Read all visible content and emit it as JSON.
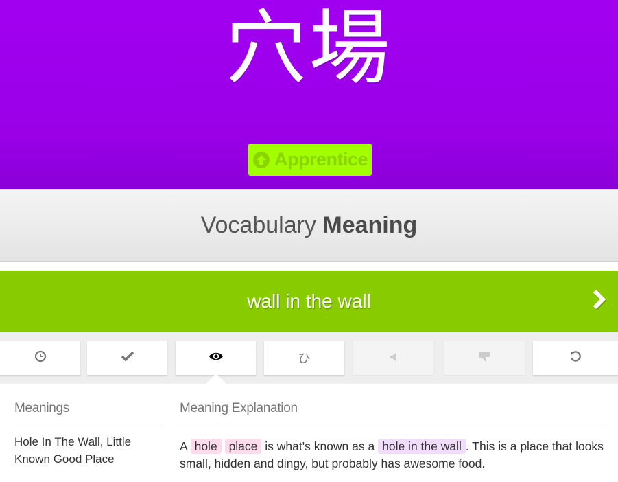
{
  "header": {
    "kanji": "穴場",
    "bg_color": "#a100f0",
    "srs_level": "Apprentice",
    "srs_icon": "arrow-up-circle-icon",
    "srs_bg_color": "#a1ff00"
  },
  "question": {
    "type_word": "Vocabulary",
    "type_emphasis": "Meaning"
  },
  "answer": {
    "value": "wall in the wall",
    "bg_color": "#88cc00",
    "next_icon": "chevron-right-icon"
  },
  "toolbar": {
    "items": [
      {
        "icon": "clock-icon",
        "state": "enabled"
      },
      {
        "icon": "check-icon",
        "state": "enabled"
      },
      {
        "icon": "eye-icon",
        "state": "active"
      },
      {
        "icon": "hiragana-hi-icon",
        "glyph": "ひ",
        "state": "enabled"
      },
      {
        "icon": "audio-icon",
        "state": "disabled"
      },
      {
        "icon": "thumbs-down-icon",
        "state": "disabled"
      },
      {
        "icon": "undo-icon",
        "state": "enabled"
      }
    ]
  },
  "info": {
    "meanings_heading": "Meanings",
    "meanings_text": "Hole In The Wall, Little Known Good Place",
    "explanation_heading": "Meaning Explanation",
    "explanation": {
      "a": "A",
      "radical_1": "hole",
      "radical_2": "place",
      "mid": "is what's known as a",
      "vocab": "hole in the wall",
      "rest": ". This is a place that looks small, hidden and dingy, but probably has awesome food."
    }
  }
}
